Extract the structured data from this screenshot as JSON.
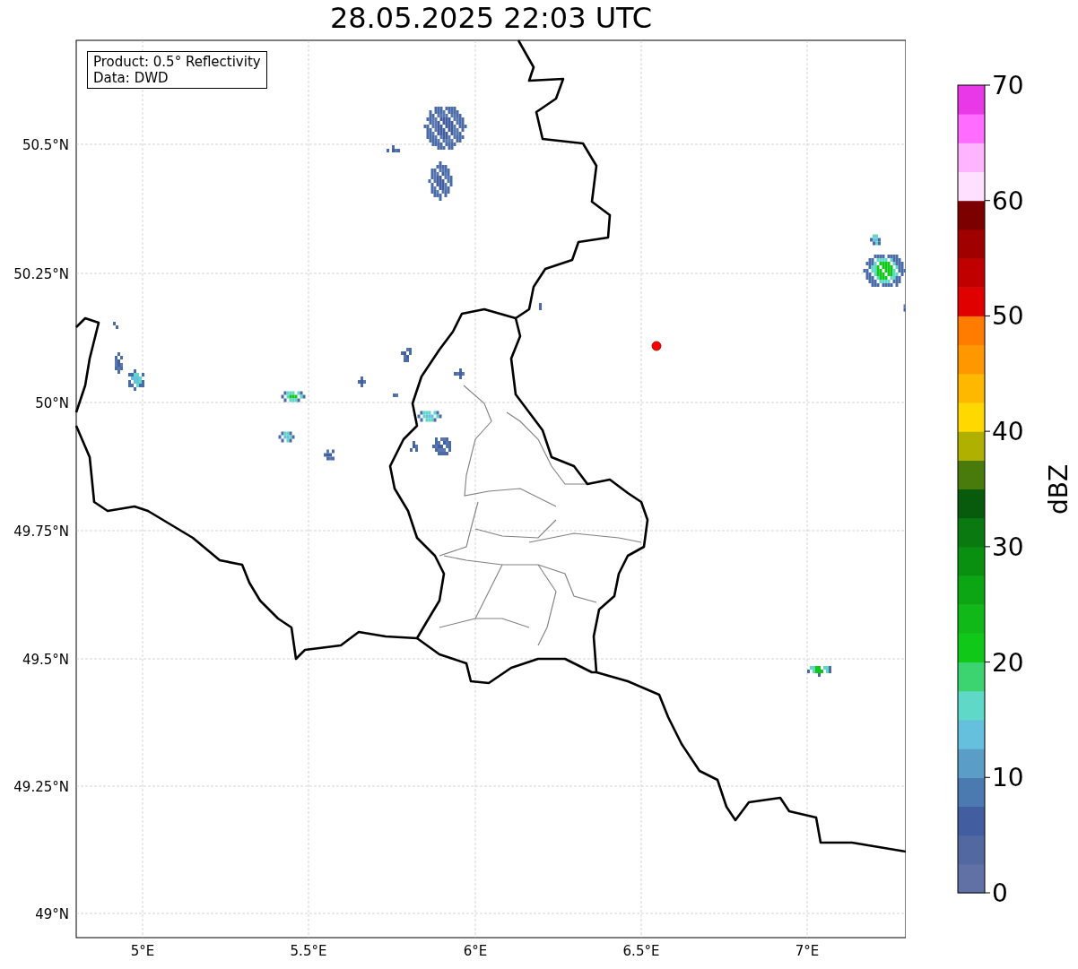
{
  "title": "28.05.2025 22:03 UTC",
  "map": {
    "legend": [
      "Product: 0.5° Reflectivity",
      "Data: DWD"
    ],
    "x_ticks": [
      "5°E",
      "5.5°E",
      "6°E",
      "6.5°E",
      "7°E"
    ],
    "y_ticks": [
      "50.5°N",
      "50.25°N",
      "50°N",
      "49.75°N",
      "49.5°N",
      "49.25°N",
      "49°N"
    ]
  },
  "colorbar": {
    "label": "dBZ",
    "ticks": [
      "70",
      "60",
      "50",
      "40",
      "30",
      "20",
      "10",
      "0"
    ],
    "bands": [
      {
        "color": "#6171a5"
      },
      {
        "color": "#5169a0"
      },
      {
        "color": "#425ea0"
      },
      {
        "color": "#4a7ab0"
      },
      {
        "color": "#5a9ec8"
      },
      {
        "color": "#64c0dc"
      },
      {
        "color": "#5fd8c8"
      },
      {
        "color": "#3cd470"
      },
      {
        "color": "#10c818"
      },
      {
        "color": "#10b818"
      },
      {
        "color": "#0ca614"
      },
      {
        "color": "#0a9010"
      },
      {
        "color": "#0a7a10"
      },
      {
        "color": "#085a0c"
      },
      {
        "color": "#487a0c"
      },
      {
        "color": "#b0b000"
      },
      {
        "color": "#ffd800"
      },
      {
        "color": "#ffb800"
      },
      {
        "color": "#ff9800"
      },
      {
        "color": "#ff7c00"
      },
      {
        "color": "#e00000"
      },
      {
        "color": "#c00000"
      },
      {
        "color": "#a00000"
      },
      {
        "color": "#7c0000"
      },
      {
        "color": "#ffe0ff"
      },
      {
        "color": "#ffb4ff"
      },
      {
        "color": "#ff6cff"
      },
      {
        "color": "#e838e8"
      }
    ]
  }
}
